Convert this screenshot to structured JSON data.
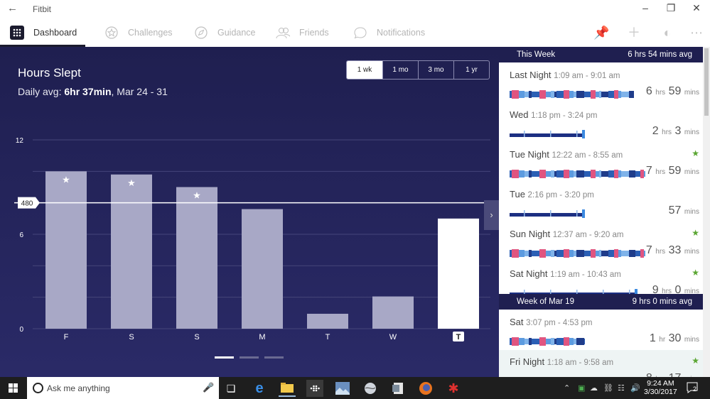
{
  "window": {
    "title": "Fitbit"
  },
  "nav": {
    "items": [
      {
        "label": "Dashboard",
        "icon": "dashboard-grid-icon",
        "active": true
      },
      {
        "label": "Challenges",
        "icon": "challenges-star-icon",
        "active": false
      },
      {
        "label": "Guidance",
        "icon": "guidance-compass-icon",
        "active": false
      },
      {
        "label": "Friends",
        "icon": "friends-icon",
        "active": false
      },
      {
        "label": "Notifications",
        "icon": "notifications-bubble-icon",
        "active": false
      }
    ],
    "right_icons": [
      "pin-icon",
      "add-icon",
      "profile-icon",
      "more-icon"
    ]
  },
  "panel": {
    "title": "Hours Slept",
    "sub_prefix": "Daily avg: ",
    "sub_avg": "6hr 37min",
    "sub_range": ", Mar 24 - 31",
    "ranges": [
      "1 wk",
      "1 mo",
      "3 mo",
      "1 yr"
    ],
    "selected_range": "1 wk",
    "goal_label": "480"
  },
  "chart_data": {
    "type": "bar",
    "title": "Hours Slept",
    "categories": [
      "F",
      "S",
      "S",
      "M",
      "T",
      "W",
      "T"
    ],
    "values": [
      10.0,
      9.8,
      9.0,
      7.6,
      0.95,
      2.05,
      7.0
    ],
    "starred": [
      true,
      true,
      true,
      false,
      false,
      false,
      false
    ],
    "highlight_index": 6,
    "y_ticks": [
      0,
      6,
      12
    ],
    "ylim": [
      0,
      12
    ],
    "goal_line": 8,
    "goal_line_label": "480",
    "colors": {
      "bar": "#a8a8c6",
      "highlight": "#ffffff",
      "bg": "#23235a"
    }
  },
  "pager": {
    "count": 3,
    "active": 0
  },
  "sleep_log": {
    "this_week": {
      "label": "This Week",
      "avg": "6 hrs 54 mins avg"
    },
    "entries_this_week": [
      {
        "name": "Last Night",
        "time": "1:09 am - 9:01 am",
        "hrs": "6",
        "mins": "59",
        "star": false,
        "style": "stages",
        "fraction": 0.66,
        "hl": false
      },
      {
        "name": "Wed",
        "time": "1:18 pm - 3:24 pm",
        "hrs": "2",
        "mins": "3",
        "star": false,
        "style": "classic",
        "fraction": 0.4,
        "hl": false
      },
      {
        "name": "Tue Night",
        "time": "12:22 am - 8:55 am",
        "hrs": "7",
        "mins": "59",
        "star": true,
        "style": "stages",
        "fraction": 0.72,
        "hl": false
      },
      {
        "name": "Tue",
        "time": "2:16 pm - 3:20 pm",
        "hrs": "",
        "mins": "57",
        "star": false,
        "style": "classic",
        "fraction": 0.4,
        "hl": false
      },
      {
        "name": "Sun Night",
        "time": "12:37 am - 9:20 am",
        "hrs": "7",
        "mins": "33",
        "star": true,
        "style": "stages",
        "fraction": 0.72,
        "hl": false
      },
      {
        "name": "Sat Night",
        "time": "1:19 am - 10:43 am",
        "hrs": "9",
        "mins": "0",
        "star": true,
        "style": "classic",
        "fraction": 0.68,
        "hl": false
      }
    ],
    "prev_week": {
      "label": "Week of Mar 19",
      "avg": "9 hrs 0 mins avg"
    },
    "entries_prev_week": [
      {
        "name": "Sat",
        "time": "3:07 pm - 4:53 pm",
        "hrs": "1",
        "mins": "30",
        "star": false,
        "style": "stages",
        "fraction": 0.4,
        "hl": false
      },
      {
        "name": "Fri Night",
        "time": "1:18 am - 9:58 am",
        "hrs": "8",
        "mins": "17",
        "star": true,
        "style": "classic",
        "fraction": 0.68,
        "hl": true
      }
    ],
    "unit_hrs": "hrs",
    "unit_hr": "hr",
    "unit_mins": "mins"
  },
  "taskbar": {
    "search_placeholder": "Ask me anything",
    "time": "9:24 AM",
    "date": "3/30/2017",
    "notifications": "2"
  }
}
